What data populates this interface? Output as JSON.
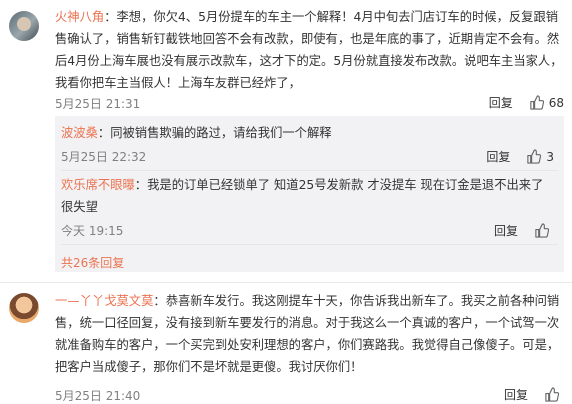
{
  "comments": [
    {
      "username": "火神八角",
      "text": "：李想，你欠4、5月份提车的车主一个解释！4月中旬去门店订车的时候，反复跟销售确认了，销售斩钉截铁地回答不会有改款，即使有，也是年底的事了，近期肯定不会有。然后4月份上海车展也没有展示改款车，这才下的定。5月份就直接发布改款。说吧车主当家人，我看你把车主当假人！上海车友群已经炸了，",
      "time": "5月25日 21:31",
      "reply_label": "回复",
      "likes": "68",
      "replies": [
        {
          "username": "波波桑",
          "text": "：同被销售欺骗的路过，请给我们一个解释",
          "time": "5月25日 22:32",
          "reply_label": "回复",
          "likes": "3"
        },
        {
          "username": "欢乐席不眼曝",
          "text": "：我是的订单已经锁单了 知道25号发新款 才没提车 现在订金是退不出来了 很失望",
          "time": "今天 19:15",
          "reply_label": "回复",
          "likes": ""
        }
      ],
      "more_replies": "共26条回复"
    },
    {
      "username": "一—丫丫戈莫文莫",
      "text": "：恭喜新车发行。我这刚提车十天，你告诉我出新车了。我买之前各种问销售，统一口径回复，没有接到新车要发行的消息。对于我这么一个真诚的客户，一个试驾一次就准备购车的客户，一个买完到处安利理想的客户，你们赛路我。我觉得自己像傻子。可是，把客户当成傻子，那你们不是坏就是更傻。我讨厌你们！",
      "time": "5月25日 21:40",
      "reply_label": "回复",
      "likes": ""
    }
  ],
  "colors": {
    "username": "#eb7350",
    "meta": "#808080",
    "reply_bg": "#f2f2f5"
  },
  "icons": {
    "like": "thumbs-up-icon"
  }
}
